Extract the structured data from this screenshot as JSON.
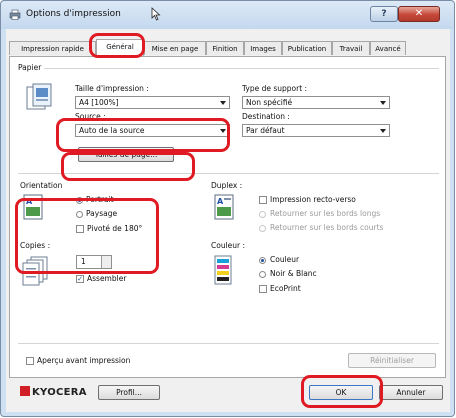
{
  "window": {
    "title": "Options d'impression",
    "help_glyph": "?",
    "close_glyph": "✕"
  },
  "tabs": [
    {
      "label": "Impression rapide"
    },
    {
      "label": "Général"
    },
    {
      "label": "Mise en page"
    },
    {
      "label": "Finition"
    },
    {
      "label": "Images"
    },
    {
      "label": "Publication"
    },
    {
      "label": "Travail"
    },
    {
      "label": "Avancé"
    }
  ],
  "papier": {
    "group_label": "Papier",
    "taille_label": "Taille d'impression :",
    "taille_value": "A4 [100%]",
    "type_label": "Type de support :",
    "type_value": "Non spécifié",
    "source_label": "Source :",
    "source_value": "Auto de la source",
    "destination_label": "Destination :",
    "destination_value": "Par défaut",
    "tailles_button": "Tailles de page..."
  },
  "orientation": {
    "group_label": "Orientation",
    "portrait": "Portrait",
    "paysage": "Paysage",
    "pivote": "Pivoté de 180°",
    "selected": "Portrait"
  },
  "duplex": {
    "group_label": "Duplex :",
    "recto_verso": "Impression recto-verso",
    "bords_longs": "Retourner sur les bords longs",
    "bords_courts": "Retourner sur les bords courts"
  },
  "copies": {
    "group_label": "Copies :",
    "value": "1",
    "assembler": "Assembler",
    "assembler_checked": true
  },
  "couleur": {
    "group_label": "Couleur :",
    "couleur": "Couleur",
    "noir_blanc": "Noir & Blanc",
    "ecoprint": "EcoPrint",
    "selected": "Couleur"
  },
  "apercu": "Aperçu avant impression",
  "reinitialiser": "Réinitialiser",
  "footer": {
    "brand": "KYOCERA",
    "profil": "Profil...",
    "ok": "OK",
    "annuler": "Annuler"
  },
  "colors": {
    "highlight": "#e01a22",
    "brand_red": "#d21f26",
    "radio_dot": "#1f4fa0"
  }
}
